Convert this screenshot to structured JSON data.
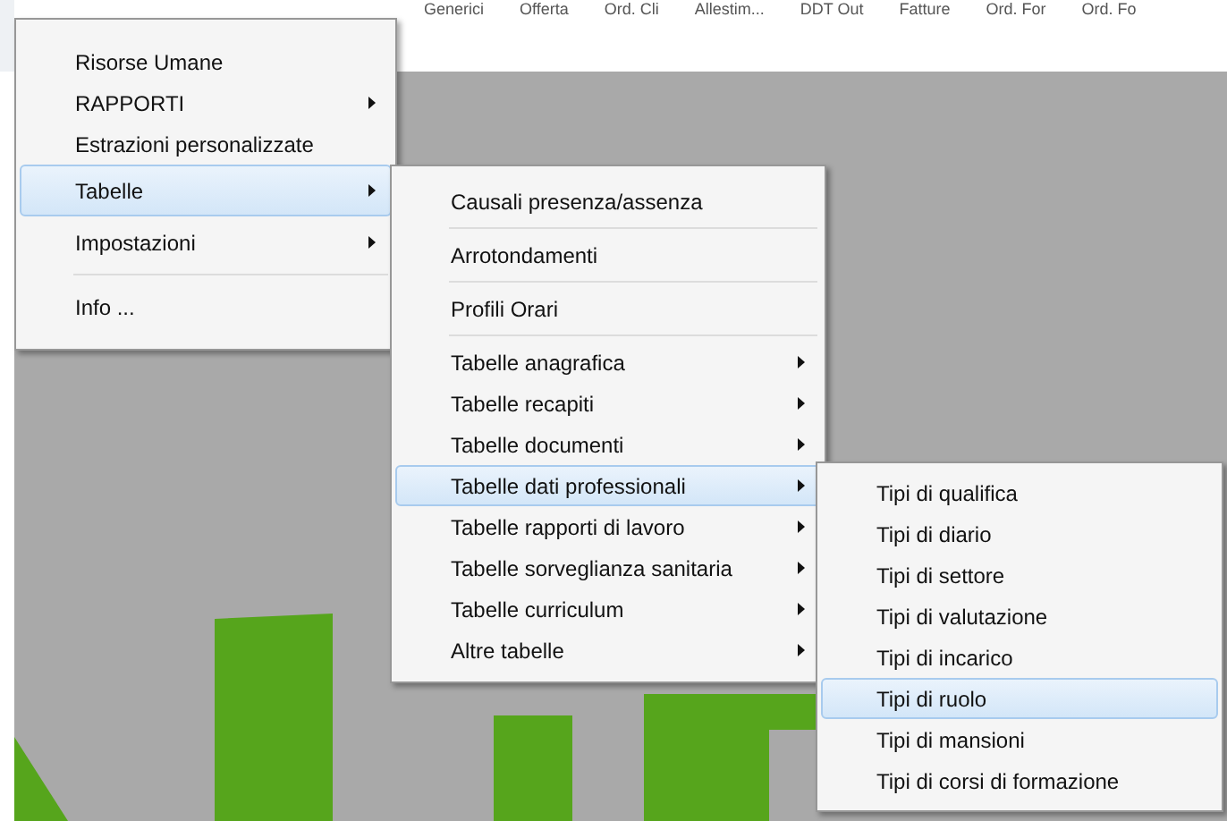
{
  "toolbar": {
    "tabs": [
      "Generici",
      "Offerta",
      "Ord. Cli",
      "Allestim...",
      "DDT Out",
      "Fatture",
      "Ord. For",
      "Ord. Fo"
    ]
  },
  "menus": [
    {
      "items": [
        {
          "kind": "item",
          "label": "Risorse Umane",
          "submenu": false,
          "selected": false
        },
        {
          "kind": "item",
          "label": "RAPPORTI",
          "submenu": true,
          "selected": false
        },
        {
          "kind": "item",
          "label": "Estrazioni personalizzate",
          "submenu": false,
          "selected": false
        },
        {
          "kind": "item",
          "label": "Tabelle",
          "submenu": true,
          "selected": true
        },
        {
          "kind": "item",
          "label": "Impostazioni",
          "submenu": true,
          "selected": false
        },
        {
          "kind": "separator"
        },
        {
          "kind": "item",
          "label": "Info  ...",
          "submenu": false,
          "selected": false
        }
      ]
    },
    {
      "items": [
        {
          "kind": "item",
          "label": "Causali presenza/assenza",
          "submenu": false,
          "selected": false
        },
        {
          "kind": "separator"
        },
        {
          "kind": "item",
          "label": "Arrotondamenti",
          "submenu": false,
          "selected": false
        },
        {
          "kind": "separator"
        },
        {
          "kind": "item",
          "label": "Profili Orari",
          "submenu": false,
          "selected": false
        },
        {
          "kind": "separator"
        },
        {
          "kind": "item",
          "label": "Tabelle anagrafica",
          "submenu": true,
          "selected": false
        },
        {
          "kind": "item",
          "label": "Tabelle recapiti",
          "submenu": true,
          "selected": false
        },
        {
          "kind": "item",
          "label": "Tabelle documenti",
          "submenu": true,
          "selected": false
        },
        {
          "kind": "item",
          "label": "Tabelle dati professionali",
          "submenu": true,
          "selected": true
        },
        {
          "kind": "item",
          "label": "Tabelle rapporti di lavoro",
          "submenu": true,
          "selected": false
        },
        {
          "kind": "item",
          "label": "Tabelle sorveglianza sanitaria",
          "submenu": true,
          "selected": false
        },
        {
          "kind": "item",
          "label": "Tabelle curriculum",
          "submenu": true,
          "selected": false
        },
        {
          "kind": "item",
          "label": "Altre tabelle",
          "submenu": true,
          "selected": false
        }
      ]
    },
    {
      "items": [
        {
          "kind": "item",
          "label": "Tipi di qualifica",
          "submenu": false,
          "selected": false
        },
        {
          "kind": "item",
          "label": "Tipi di diario",
          "submenu": false,
          "selected": false
        },
        {
          "kind": "item",
          "label": "Tipi di settore",
          "submenu": false,
          "selected": false
        },
        {
          "kind": "item",
          "label": "Tipi di valutazione",
          "submenu": false,
          "selected": false
        },
        {
          "kind": "item",
          "label": "Tipi di incarico",
          "submenu": false,
          "selected": false
        },
        {
          "kind": "item",
          "label": "Tipi di ruolo",
          "submenu": false,
          "selected": true
        },
        {
          "kind": "item",
          "label": "Tipi di mansioni",
          "submenu": false,
          "selected": false
        },
        {
          "kind": "item",
          "label": "Tipi di corsi di formazione",
          "submenu": false,
          "selected": false
        }
      ]
    }
  ]
}
